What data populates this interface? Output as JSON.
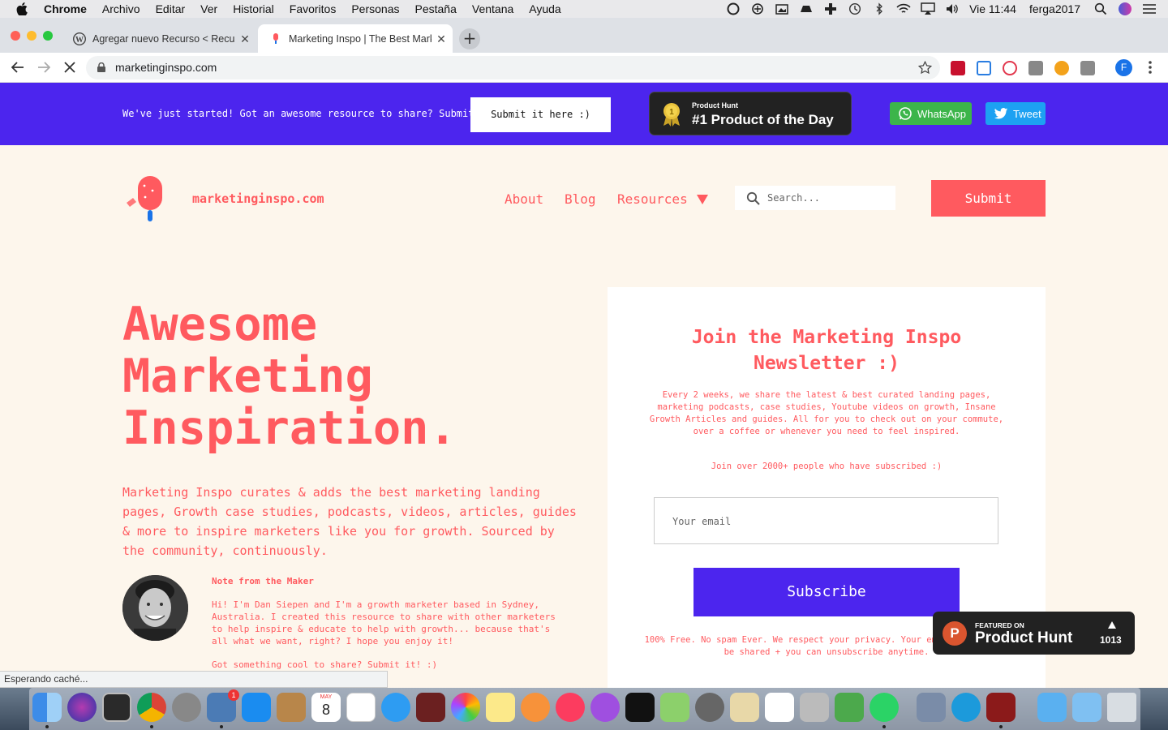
{
  "menubar": {
    "app": "Chrome",
    "items": [
      "Archivo",
      "Editar",
      "Ver",
      "Historial",
      "Favoritos",
      "Personas",
      "Pestaña",
      "Ventana",
      "Ayuda"
    ],
    "clock": "Vie 11:44",
    "user": "ferga2017"
  },
  "tabs": [
    {
      "title": "Agregar nuevo Recurso < Recursos",
      "favicon": "wordpress-icon"
    },
    {
      "title": "Marketing Inspo | The Best Marketing",
      "favicon": "marketing-inspo-icon"
    }
  ],
  "address": {
    "url": "marketinginspo.com"
  },
  "banner": {
    "message": "We've just started! Got an awesome resource to share? Submit it!",
    "submit_label": "Submit it here :)",
    "ph_small": "Product Hunt",
    "ph_big": "#1 Product of the Day",
    "medal_number": "1",
    "whatsapp": "WhatsApp",
    "tweet": "Tweet"
  },
  "header": {
    "site_name": "marketinginspo.com",
    "nav": [
      "About",
      "Blog",
      "Resources"
    ],
    "search_placeholder": "Search...",
    "submit": "Submit"
  },
  "hero": {
    "title_lines": [
      "Awesome",
      "Marketing",
      "Inspiration."
    ],
    "description": "Marketing Inspo curates & adds the best marketing landing pages, Growth case studies, podcasts, videos, articles, guides & more to inspire marketers like you for growth. Sourced by the community, continuously.",
    "note_title": "Note from the Maker",
    "note_body": "Hi! I'm Dan Siepen and I'm a growth marketer based in Sydney, Australia. I created this resource to share with other marketers to help inspire & educate to help with growth... because that's all what we want, right? I hope you enjoy it!",
    "note_cta": "Got something cool to share? Submit it! :)"
  },
  "newsletter": {
    "title": "Join the Marketing Inspo Newsletter :)",
    "description": "Every 2 weeks, we share the latest & best curated landing pages, marketing podcasts, case studies, Youtube videos on growth, Insane Growth Articles and guides. All for you to check out on your commute, over a coffee or whenever you need to feel inspired.",
    "join": "Join over 2000+ people who have subscribed :)",
    "email_placeholder": "Your email",
    "subscribe": "Subscribe",
    "footer": "100% Free. No spam Ever. We respect your privacy. Your email will never be shared + you can unsubscribe anytime."
  },
  "ph_float": {
    "small": "FEATURED ON",
    "big": "Product Hunt",
    "count": "1013",
    "letter": "P"
  },
  "status": "Esperando caché...",
  "dock": {
    "calendar_month": "MAY",
    "calendar_day": "8",
    "badge": "1"
  },
  "colors": {
    "brand": "#FF5A5F",
    "accent": "#4C25EE",
    "page_bg": "#FDF6EC"
  }
}
